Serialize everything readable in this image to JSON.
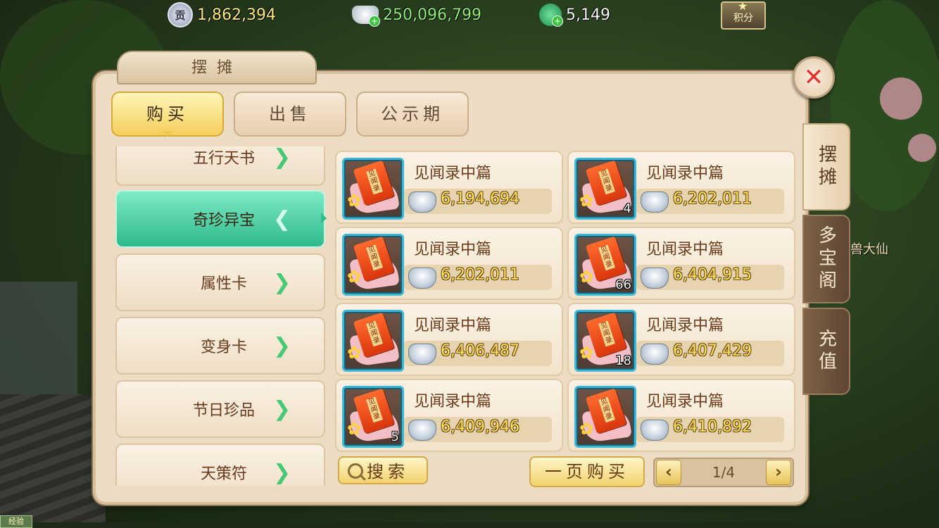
{
  "currencies": [
    {
      "icon": "contribution-icon",
      "icon_glyph": "贡",
      "value": "1,862,394"
    },
    {
      "icon": "silver-ingot-icon",
      "value": "250,096,799"
    },
    {
      "icon": "jade-icon",
      "value": "5,149"
    }
  ],
  "score_button": {
    "label": "积分"
  },
  "panel": {
    "title": "摆摊"
  },
  "tabs": [
    {
      "label": "购买",
      "active": true
    },
    {
      "label": "出售",
      "active": false
    },
    {
      "label": "公示期",
      "active": false
    }
  ],
  "side_tabs": [
    {
      "label": "摆摊",
      "active": true
    },
    {
      "label": "多宝阁",
      "active": false
    },
    {
      "label": "充值",
      "active": false
    }
  ],
  "categories": [
    {
      "label": "五行天书",
      "active": false
    },
    {
      "label": "奇珍异宝",
      "active": true
    },
    {
      "label": "属性卡",
      "active": false
    },
    {
      "label": "变身卡",
      "active": false
    },
    {
      "label": "节日珍品",
      "active": false
    },
    {
      "label": "天策符",
      "active": false
    }
  ],
  "items": [
    {
      "name": "见闻录中篇",
      "price": "6,194,694",
      "qty": ""
    },
    {
      "name": "见闻录中篇",
      "price": "6,202,011",
      "qty": "4"
    },
    {
      "name": "见闻录中篇",
      "price": "6,202,011",
      "qty": ""
    },
    {
      "name": "见闻录中篇",
      "price": "6,404,915",
      "qty": "66"
    },
    {
      "name": "见闻录中篇",
      "price": "6,406,487",
      "qty": ""
    },
    {
      "name": "见闻录中篇",
      "price": "6,407,429",
      "qty": "18"
    },
    {
      "name": "见闻录中篇",
      "price": "6,409,946",
      "qty": "5"
    },
    {
      "name": "见闻录中篇",
      "price": "6,410,892",
      "qty": ""
    }
  ],
  "item_icon_text": "见闻录",
  "search_button": {
    "label": "搜索"
  },
  "buy_page_button": {
    "label": "一页购买"
  },
  "pager": {
    "text": "1/4",
    "prev": "‹",
    "next": "›"
  },
  "background_npc_label": "兽大仙",
  "exp_label": "经验",
  "colors": {
    "accent_active": "#2fb98c",
    "price_text": "#ffe25a",
    "item_name": "#6b3a1b",
    "close_x": "#e2332a"
  }
}
